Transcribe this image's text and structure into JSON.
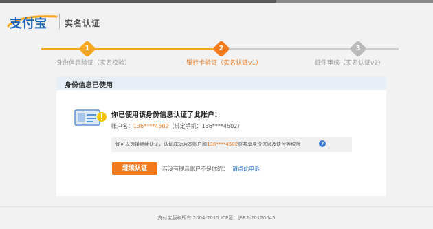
{
  "header": {
    "logo_text": "支付宝",
    "title": "实名认证"
  },
  "steps": [
    {
      "num": "1",
      "label": "身份信息验证（实名校验）",
      "state": "done"
    },
    {
      "num": "2",
      "label": "银行卡验证（实名认证v1）",
      "state": "active"
    },
    {
      "num": "3",
      "label": "证件审核（实名认证v2）",
      "state": "todo"
    }
  ],
  "panel": {
    "header": "身份信息已使用",
    "message_title": "你已使用该身份信息认证了此账户：",
    "account_label": "账户名：",
    "account_value": "136****4502",
    "phone_label": "（绑定手机：",
    "phone_value": "136****4502）",
    "note_part1": "你可以选择继续认证，认证成功后本账户和",
    "note_account": "136****4502",
    "note_part2": "将共享身份信息及快付等权限",
    "help_icon": "?",
    "continue_button": "继续认证",
    "hint_text": "若没有提示账户不是你的：",
    "hint_link": "请点此申诉"
  },
  "footer": {
    "copyright": "支付宝版权所有 2004-2015 ICP证：沪B2-20120045"
  },
  "colors": {
    "accent": "#f37b1d",
    "step_done": "#f5a623",
    "step_todo": "#bbbbbb",
    "link": "#1a66c9"
  }
}
